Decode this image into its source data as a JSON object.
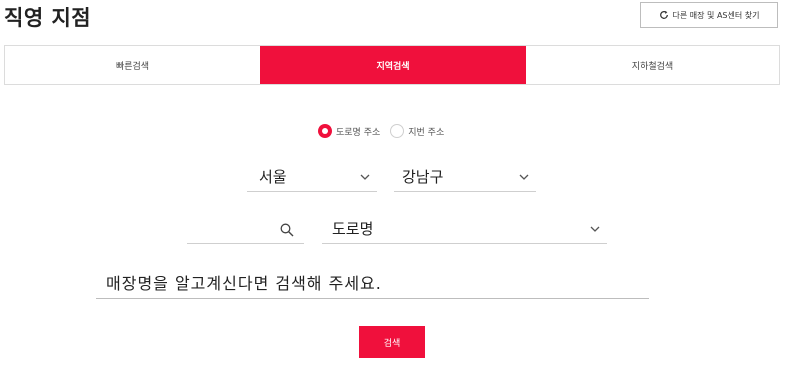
{
  "page_title": "직영 지점",
  "other_store_button": {
    "label": "다른 매장 및 AS센터 찾기",
    "icon": "refresh-icon"
  },
  "tabs": [
    {
      "label": "빠른검색",
      "active": false
    },
    {
      "label": "지역검색",
      "active": true
    },
    {
      "label": "지하철검색",
      "active": false
    }
  ],
  "address_type": {
    "options": [
      {
        "label": "도로명 주소",
        "checked": true
      },
      {
        "label": "지번 주소",
        "checked": false
      }
    ]
  },
  "region": {
    "city": "서울",
    "district": "강남구"
  },
  "road": {
    "search_icon": "search-icon",
    "select_value": "도로명"
  },
  "store_search": {
    "placeholder": "매장명을 알고계신다면 검색해 주세요."
  },
  "search_button": {
    "label": "검색"
  },
  "colors": {
    "accent": "#f0103c"
  }
}
